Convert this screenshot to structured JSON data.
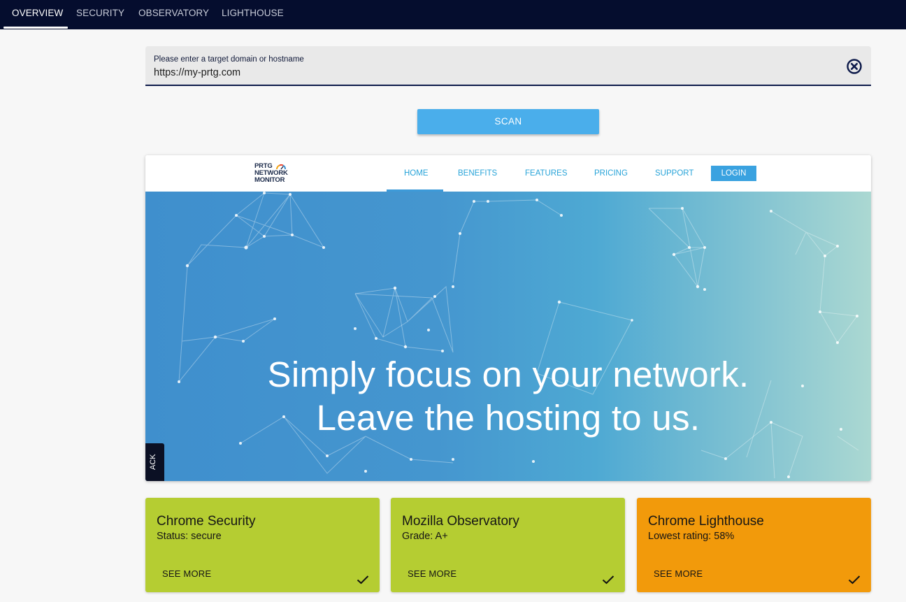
{
  "topnav": {
    "tabs": [
      {
        "label": "OVERVIEW"
      },
      {
        "label": "SECURITY"
      },
      {
        "label": "OBSERVATORY"
      },
      {
        "label": "LIGHTHOUSE"
      }
    ]
  },
  "target": {
    "label": "Please enter a target domain or hostname",
    "value": "https://my-prtg.com"
  },
  "scan_button": "SCAN",
  "preview": {
    "logo": {
      "line1": "PRTG",
      "line2": "NETWORK",
      "line3": "MONITOR"
    },
    "nav": [
      "HOME",
      "BENEFITS",
      "FEATURES",
      "PRICING",
      "SUPPORT"
    ],
    "login": "LOGIN",
    "hero_line1": "Simply focus on your network.",
    "hero_line2": "Leave the hosting to us.",
    "feedback_tab": "ACK"
  },
  "cards": [
    {
      "title": "Chrome Security",
      "subtitle": "Status: secure",
      "button": "SEE MORE",
      "color": "#b5cd32"
    },
    {
      "title": "Mozilla Observatory",
      "subtitle": "Grade: A+",
      "button": "SEE MORE",
      "color": "#b5cd32"
    },
    {
      "title": "Chrome Lighthouse",
      "subtitle": "Lowest rating: 58%",
      "button": "SEE MORE",
      "color": "#f29a0b"
    }
  ],
  "colors": {
    "nav_bg": "#050d2e",
    "scan": "#4aaeeb",
    "green": "#b5cd32",
    "orange": "#f29a0b"
  }
}
